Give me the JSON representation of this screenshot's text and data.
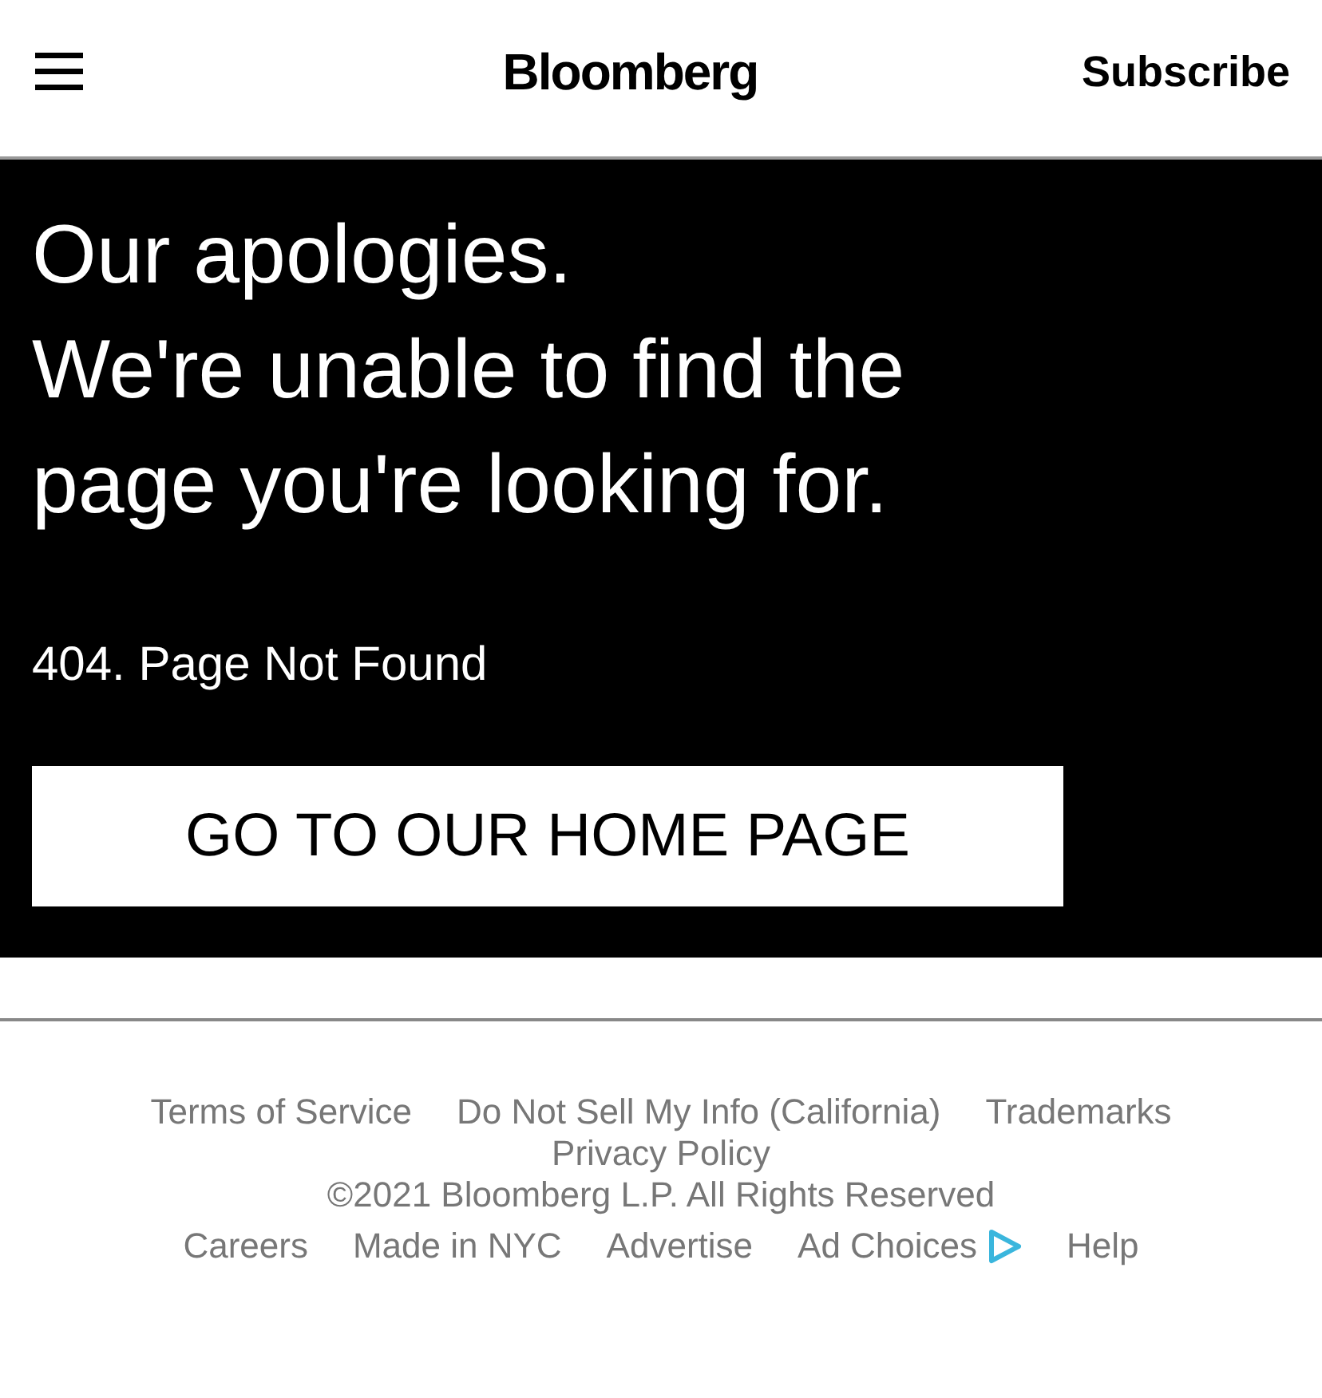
{
  "header": {
    "logo": "Bloomberg",
    "subscribe": "Subscribe"
  },
  "error": {
    "heading_lines": [
      "Our apologies.",
      "We're unable to find the",
      "page you're looking for."
    ],
    "code": "404. Page Not Found",
    "button": "GO TO OUR HOME PAGE"
  },
  "footer": {
    "top_links": [
      "Terms of Service",
      "Do Not Sell My Info (California)",
      "Trademarks"
    ],
    "privacy_link": "Privacy Policy",
    "copyright": "©2021 Bloomberg L.P. All Rights Reserved",
    "bottom_links": [
      {
        "label": "Careers",
        "kind": "link"
      },
      {
        "label": "Made in NYC",
        "kind": "link"
      },
      {
        "label": "Advertise",
        "kind": "link"
      },
      {
        "label": "Ad Choices",
        "kind": "adchoices"
      },
      {
        "label": "Help",
        "kind": "link"
      }
    ]
  }
}
